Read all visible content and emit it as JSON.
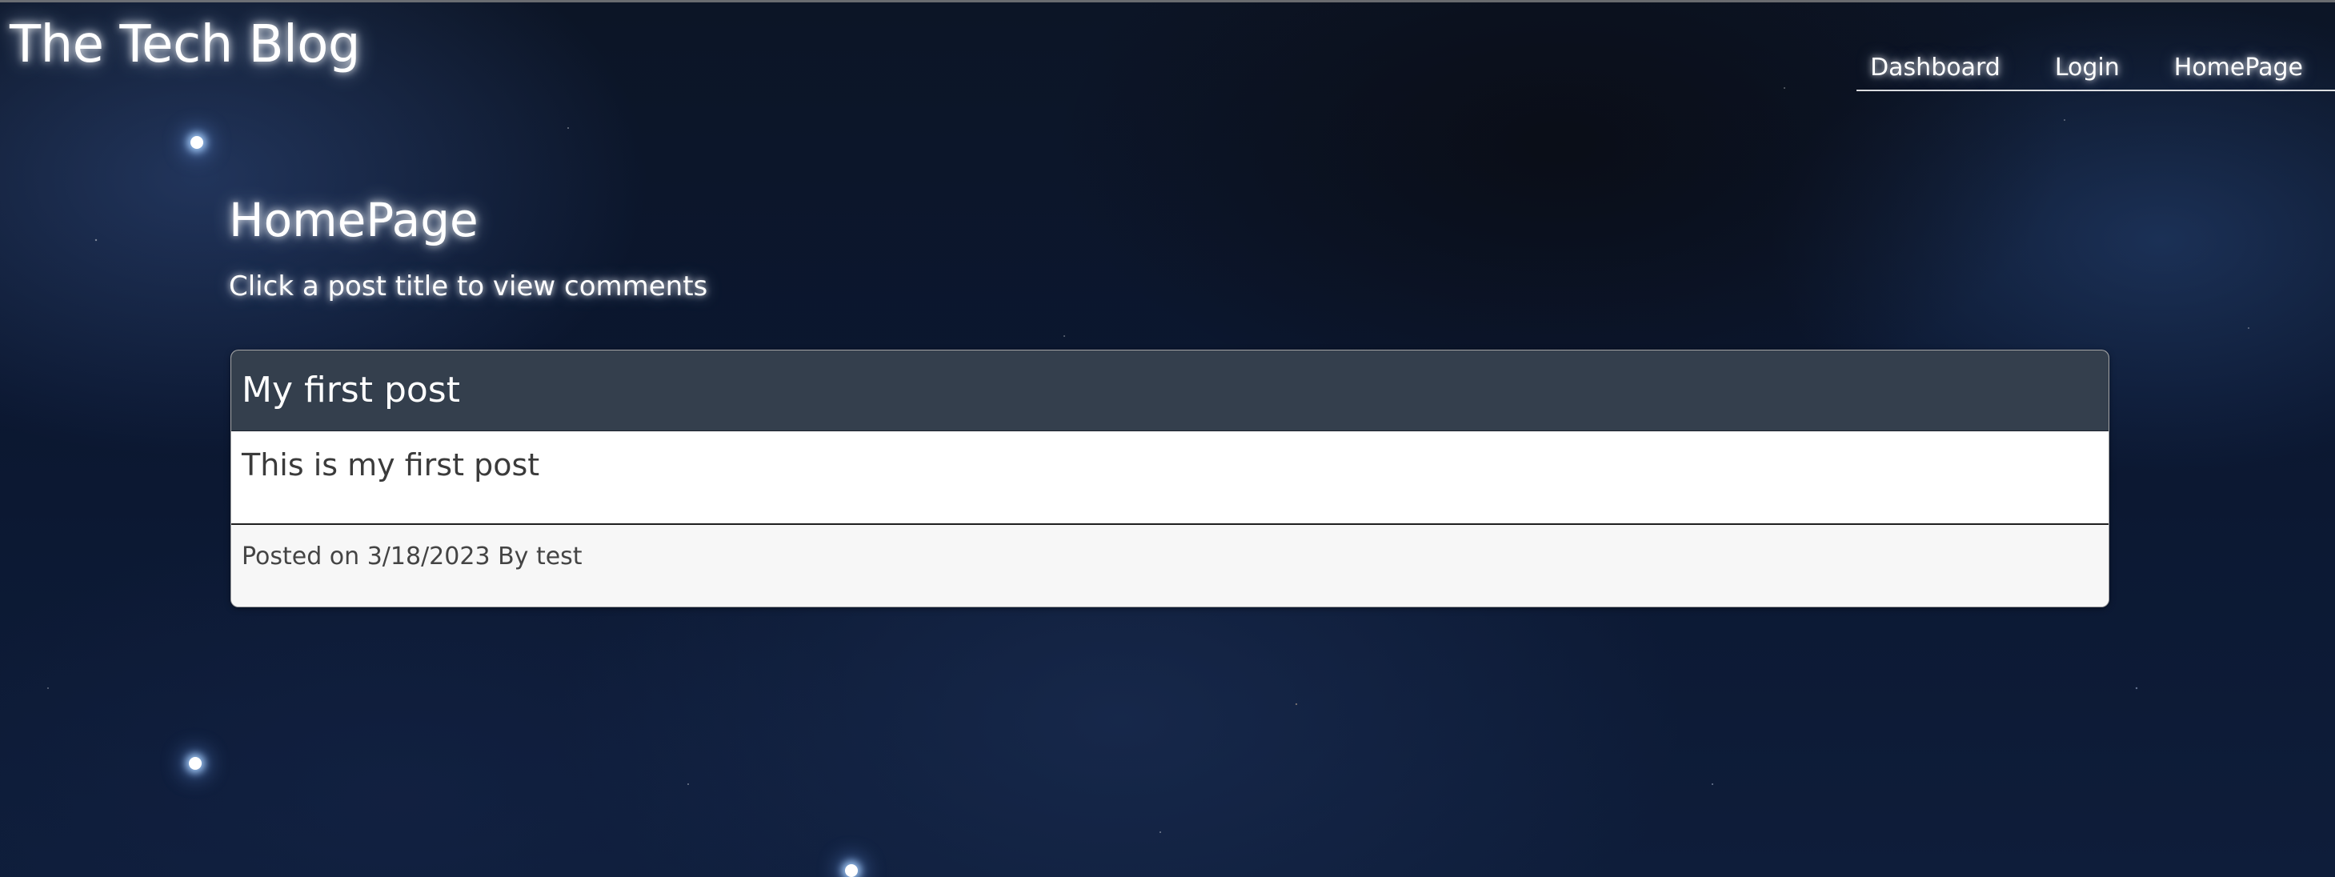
{
  "site": {
    "brand": "The Tech Blog"
  },
  "nav": {
    "items": [
      {
        "label": "Dashboard"
      },
      {
        "label": "Login"
      },
      {
        "label": "HomePage"
      }
    ]
  },
  "page": {
    "title": "HomePage",
    "subtitle": "Click a post title to view comments"
  },
  "posts": [
    {
      "title": "My first post",
      "content": "This is my first post",
      "meta": "Posted on 3/18/2023 By test"
    }
  ],
  "colors": {
    "background": "#0c1526",
    "header_bar": "#343f4d",
    "card_body": "#ffffff",
    "card_footer": "#f7f7f7",
    "text_light": "#ffffff",
    "text_dark": "#3b3b3b"
  }
}
